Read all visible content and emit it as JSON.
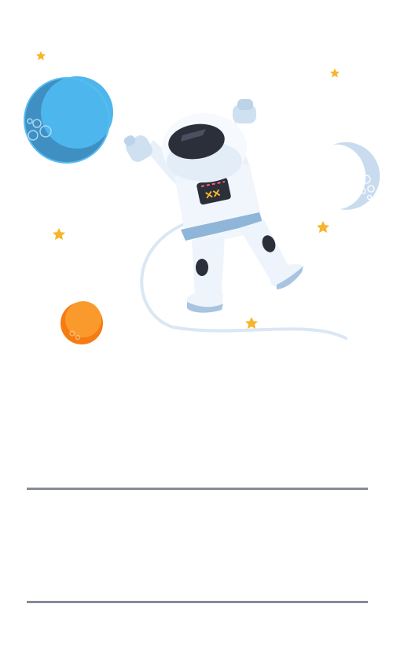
{
  "illustration": {
    "subject": "astronaut-floating-in-space",
    "badge_symbol": "××",
    "colors": {
      "planet_blue": "#4db6ec",
      "planet_orange": "#fb8c1c",
      "moon": "#c9dcef",
      "star": "#f7b52b",
      "suit": "#eef4fb",
      "suit_shadow": "#cfe0f0",
      "visor": "#2b2f3a",
      "stripe": "#8fb6d8",
      "tether": "#dbe7f3"
    }
  },
  "dividers": {
    "color": "#868a99"
  }
}
